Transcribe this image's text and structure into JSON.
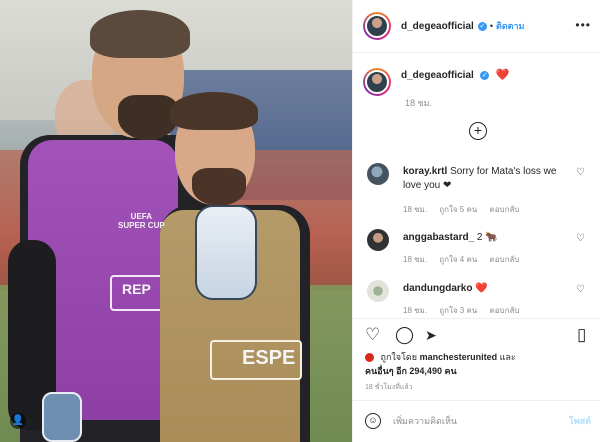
{
  "header": {
    "username": "d_degeaofficial",
    "verified_icon": "verified-badge-icon",
    "separator": "•",
    "follow_label": "ติดตาม",
    "more_icon": "•••"
  },
  "caption": {
    "username": "d_degeaofficial",
    "emoji": "❤️",
    "time": "18 ชม."
  },
  "load_more_icon": "+",
  "comments": [
    {
      "username": "koray.krtl",
      "text": "Sorry for Mata's loss we love you ❤",
      "time": "18 ชม.",
      "likes": "ถูกใจ 5 คน",
      "reply": "ตอบกลับ"
    },
    {
      "username": "anggabastard_",
      "text": "2 🐂",
      "time": "18 ชม.",
      "likes": "ถูกใจ 4 คน",
      "reply": "ตอบกลับ"
    },
    {
      "username": "dandungdarko",
      "text": "❤️",
      "time": "18 ชม.",
      "likes": "ถูกใจ 3 คน",
      "reply": "ตอบกลับ"
    }
  ],
  "actions": {
    "like_icon": "♡",
    "comment_icon": "◯",
    "share_icon": "➤",
    "save_icon": "▯"
  },
  "likes_line": {
    "prefix": "ถูกใจโดย",
    "user": "manchesterunited",
    "mid": "และ",
    "others": "คนอื่นๆ อีก 294,490 คน"
  },
  "posted": "18 ชั่วโมงที่แล้ว",
  "add_comment": {
    "placeholder": "เพิ่มความคิดเห็น",
    "post_label": "โพสต์"
  },
  "photo_text": {
    "uefa": "UEFA\nSUPER CUP",
    "rep": "REP",
    "espe": "ESPE"
  }
}
